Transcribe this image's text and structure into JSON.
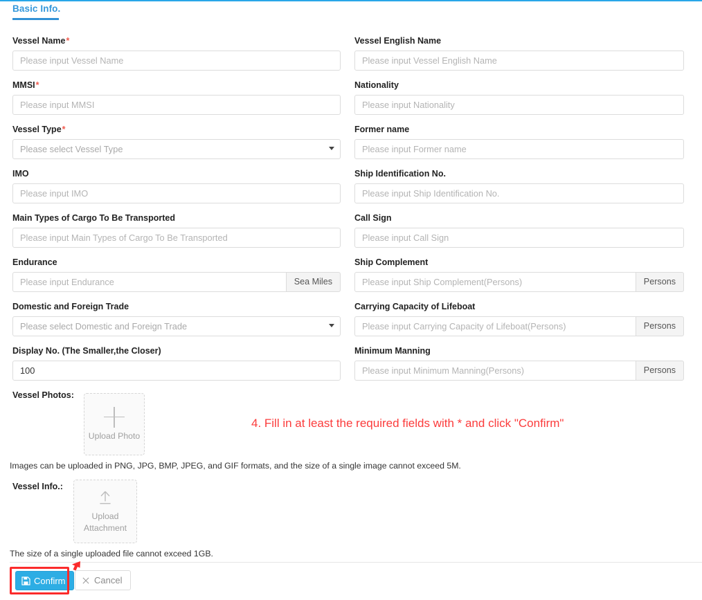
{
  "tab": {
    "label": "Basic Info."
  },
  "colors": {
    "accent": "#29a7e8",
    "tab_active": "#3498db",
    "required": "#f05b4f",
    "annotation": "#fb3b3b",
    "confirm": "#2dade4"
  },
  "left_fields": [
    {
      "label": "Vessel Name",
      "required": true,
      "type": "input",
      "placeholder": "Please input Vessel Name",
      "value": ""
    },
    {
      "label": "MMSI",
      "required": true,
      "type": "input",
      "placeholder": "Please input MMSI",
      "value": ""
    },
    {
      "label": "Vessel Type",
      "required": true,
      "type": "select",
      "placeholder": "Please select Vessel Type",
      "value": ""
    },
    {
      "label": "IMO",
      "required": false,
      "type": "input",
      "placeholder": "Please input IMO",
      "value": ""
    },
    {
      "label": "Main Types of Cargo To Be Transported",
      "required": false,
      "type": "input",
      "placeholder": "Please input Main Types of Cargo To Be Transported",
      "value": ""
    },
    {
      "label": "Endurance",
      "required": false,
      "type": "input",
      "placeholder": "Please input Endurance",
      "value": "",
      "addon": "Sea Miles"
    },
    {
      "label": "Domestic and Foreign Trade",
      "required": false,
      "type": "select",
      "placeholder": "Please select Domestic and Foreign Trade",
      "value": ""
    },
    {
      "label": "Display No.  (The Smaller,the Closer)",
      "required": false,
      "type": "input",
      "placeholder": "",
      "value": "100"
    }
  ],
  "right_fields": [
    {
      "label": "Vessel English Name",
      "required": false,
      "type": "input",
      "placeholder": "Please input Vessel English Name",
      "value": ""
    },
    {
      "label": "Nationality",
      "required": false,
      "type": "input",
      "placeholder": "Please input Nationality",
      "value": ""
    },
    {
      "label": "Former name",
      "required": false,
      "type": "input",
      "placeholder": "Please input Former name",
      "value": ""
    },
    {
      "label": "Ship Identification No.",
      "required": false,
      "type": "input",
      "placeholder": "Please input Ship Identification No.",
      "value": ""
    },
    {
      "label": "Call Sign",
      "required": false,
      "type": "input",
      "placeholder": "Please input Call Sign",
      "value": ""
    },
    {
      "label": "Ship Complement",
      "required": false,
      "type": "input",
      "placeholder": "Please input Ship Complement(Persons)",
      "value": "",
      "addon": "Persons"
    },
    {
      "label": "Carrying Capacity of Lifeboat",
      "required": false,
      "type": "input",
      "placeholder": "Please input Carrying Capacity of Lifeboat(Persons)",
      "value": "",
      "addon": "Persons"
    },
    {
      "label": "Minimum Manning",
      "required": false,
      "type": "input",
      "placeholder": "Please input Minimum Manning(Persons)",
      "value": "",
      "addon": "Persons"
    }
  ],
  "uploads": {
    "photo": {
      "label": "Vessel Photos:",
      "box_text": "Upload Photo",
      "icon": "plus-icon",
      "hint": "Images can be uploaded in PNG, JPG, BMP, JPEG, and GIF formats, and the size of a single image cannot exceed 5M."
    },
    "attachment": {
      "label": "Vessel Info.:",
      "box_text_line1": "Upload",
      "box_text_line2": "Attachment",
      "icon": "upload-arrow-icon",
      "hint": "The size of a single uploaded file cannot exceed 1GB."
    }
  },
  "annotation": {
    "text": "4. Fill in at least the required fields with * and click \"Confirm\""
  },
  "footer": {
    "confirm_label": "Confirm",
    "confirm_icon": "save-icon",
    "cancel_label": "Cancel",
    "cancel_icon": "close-x-icon"
  }
}
